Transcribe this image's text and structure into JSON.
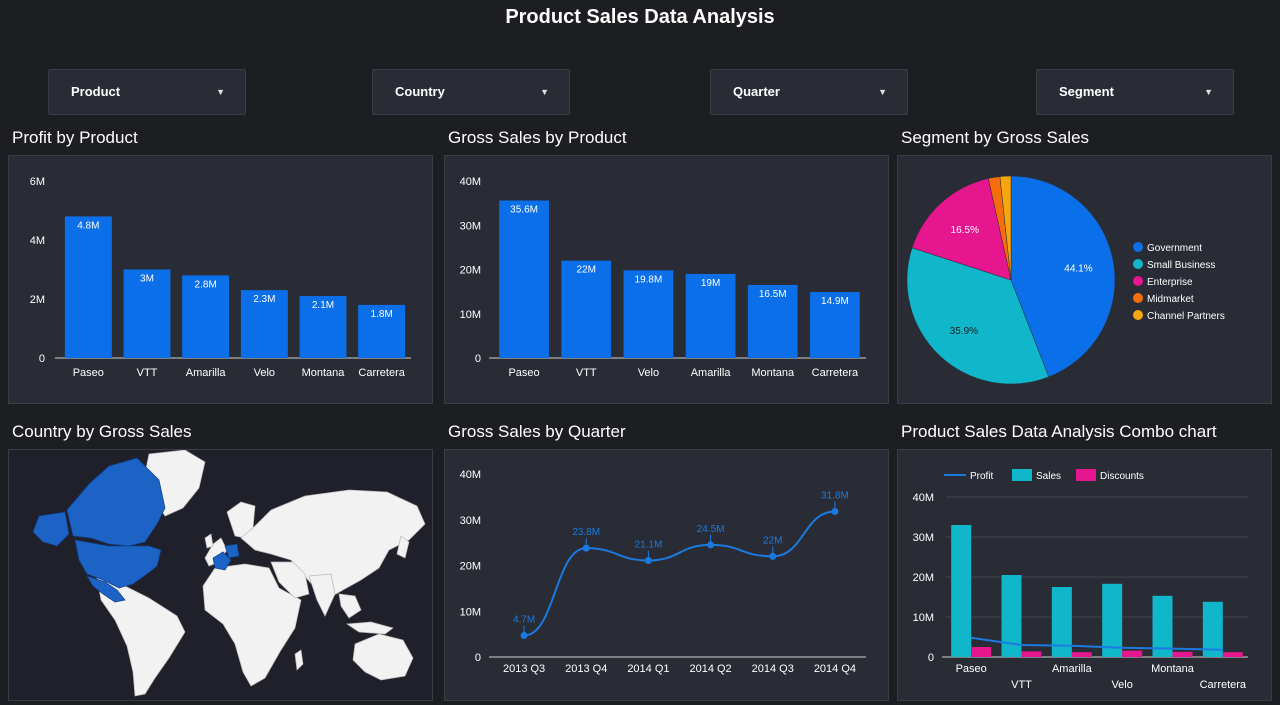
{
  "page_title": "Product Sales Data Analysis",
  "filters": [
    "Product",
    "Country",
    "Quarter",
    "Segment"
  ],
  "section_titles": {
    "profit": "Profit by Product",
    "gross": "Gross Sales by Product",
    "segment": "Segment by Gross Sales",
    "country": "Country by Gross Sales",
    "quarter": "Gross Sales by Quarter",
    "combo": "Product Sales Data Analysis Combo chart"
  },
  "colors": {
    "bar_blue": "#0a6fe8",
    "line_blue": "#1a7ae0",
    "teal": "#10b6c9",
    "pink": "#e5168e",
    "orange": "#f66d0b",
    "gold": "#f6a70e",
    "map_highlight": "#1c63c5"
  },
  "chart_data": [
    {
      "type": "bar",
      "title": "Profit by Product",
      "categories": [
        "Paseo",
        "VTT",
        "Amarilla",
        "Velo",
        "Montana",
        "Carretera"
      ],
      "values": [
        4.8,
        3.0,
        2.8,
        2.3,
        2.1,
        1.8
      ],
      "data_labels": [
        "4.8M",
        "3M",
        "2.8M",
        "2.3M",
        "2.1M",
        "1.8M"
      ],
      "unit": "M",
      "ylim": [
        0,
        6
      ],
      "yticks": [
        "0",
        "2M",
        "4M",
        "6M"
      ]
    },
    {
      "type": "bar",
      "title": "Gross Sales by Product",
      "categories": [
        "Paseo",
        "VTT",
        "Velo",
        "Amarilla",
        "Montana",
        "Carretera"
      ],
      "values": [
        35.6,
        22,
        19.8,
        19,
        16.5,
        14.9
      ],
      "data_labels": [
        "35.6M",
        "22M",
        "19.8M",
        "19M",
        "16.5M",
        "14.9M"
      ],
      "unit": "M",
      "ylim": [
        0,
        40
      ],
      "yticks": [
        "0",
        "10M",
        "20M",
        "30M",
        "40M"
      ]
    },
    {
      "type": "pie",
      "title": "Segment by Gross Sales",
      "categories": [
        "Government",
        "Small Business",
        "Enterprise",
        "Midmarket",
        "Channel Partners"
      ],
      "values": [
        44.1,
        35.9,
        16.5,
        1.8,
        1.7
      ],
      "data_labels": [
        "44.1%",
        "35.9%",
        "16.5%",
        "",
        ""
      ],
      "colors": [
        "#0a6fe8",
        "#10b6c9",
        "#e5168e",
        "#f66d0b",
        "#f6a70e"
      ],
      "legend": "right"
    },
    {
      "type": "line",
      "title": "Gross Sales by Quarter",
      "x": [
        "2013 Q3",
        "2013 Q4",
        "2014 Q1",
        "2014 Q2",
        "2014 Q3",
        "2014 Q4"
      ],
      "values": [
        4.7,
        23.8,
        21.1,
        24.5,
        22,
        31.8
      ],
      "data_labels": [
        "4.7M",
        "23.8M",
        "21.1M",
        "24.5M",
        "22M",
        "31.8M"
      ],
      "unit": "M",
      "ylim": [
        0,
        40
      ],
      "yticks": [
        "0",
        "10M",
        "20M",
        "30M",
        "40M"
      ]
    },
    {
      "type": "bar",
      "title": "Product Sales Data Analysis Combo chart",
      "categories": [
        "Paseo",
        "VTT",
        "Amarilla",
        "Velo",
        "Montana",
        "Carretera"
      ],
      "series": [
        {
          "name": "Profit",
          "kind": "line",
          "values": [
            4.8,
            3.0,
            2.8,
            2.3,
            2.1,
            1.8
          ]
        },
        {
          "name": "Sales",
          "kind": "bar",
          "values": [
            33,
            20.5,
            17.5,
            18.3,
            15.3,
            13.8
          ]
        },
        {
          "name": "Discounts",
          "kind": "bar",
          "values": [
            2.5,
            1.4,
            1.2,
            1.6,
            1.3,
            1.2
          ]
        }
      ],
      "unit": "M",
      "ylim": [
        0,
        40
      ],
      "yticks": [
        "0",
        "10M",
        "20M",
        "30M",
        "40M"
      ],
      "legend": "top-left"
    }
  ]
}
